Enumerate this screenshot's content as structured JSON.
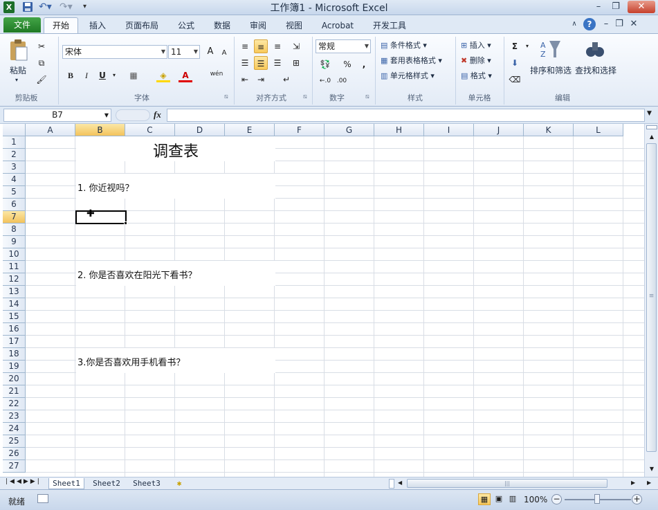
{
  "window": {
    "title": "工作簿1 - Microsoft Excel"
  },
  "tabs": [
    {
      "label": "文件"
    },
    {
      "label": "开始"
    },
    {
      "label": "插入"
    },
    {
      "label": "页面布局"
    },
    {
      "label": "公式"
    },
    {
      "label": "数据"
    },
    {
      "label": "审阅"
    },
    {
      "label": "视图"
    },
    {
      "label": "Acrobat"
    },
    {
      "label": "开发工具"
    }
  ],
  "ribbon": {
    "clipboard": {
      "paste": "粘贴",
      "group": "剪贴板"
    },
    "font": {
      "name": "宋体",
      "size": "11",
      "bold": "B",
      "italic": "I",
      "underline": "U",
      "grow": "A",
      "shrink": "A",
      "wen": "wén",
      "group": "字体"
    },
    "alignment": {
      "group": "对齐方式"
    },
    "number": {
      "format": "常规",
      "percent": "%",
      "comma": ",",
      "group": "数字"
    },
    "styles": {
      "conditional": "条件格式",
      "table": "套用表格格式",
      "cell": "单元格样式",
      "group": "样式"
    },
    "cells": {
      "insert": "插入",
      "delete": "删除",
      "format": "格式",
      "group": "单元格"
    },
    "editing": {
      "sort": "排序和筛选",
      "find": "查找和选择",
      "group": "编辑"
    }
  },
  "formula_bar": {
    "name_box": "B7",
    "fx": "fx",
    "value": ""
  },
  "columns": [
    "A",
    "B",
    "C",
    "D",
    "E",
    "F",
    "G",
    "H",
    "I",
    "J",
    "K",
    "L"
  ],
  "rows": [
    "1",
    "2",
    "3",
    "4",
    "5",
    "6",
    "7",
    "8",
    "9",
    "10",
    "11",
    "12",
    "13",
    "14",
    "15",
    "16",
    "17",
    "18",
    "19",
    "20",
    "21",
    "22",
    "23",
    "24",
    "25",
    "26",
    "27"
  ],
  "cells": {
    "title": "调查表",
    "q1": "1. 你近视吗？",
    "q2": "2. 你是否喜欢在阳光下看书？",
    "q3": "3.你是否喜欢用手机看书？"
  },
  "selected_cell": "B7",
  "sheets": [
    "Sheet1",
    "Sheet2",
    "Sheet3"
  ],
  "status": {
    "ready": "就绪",
    "zoom": "100%"
  },
  "colors": {
    "file_tab": "#2b8a33",
    "selection": "#f3c35c",
    "accent": "#1e2d44"
  }
}
